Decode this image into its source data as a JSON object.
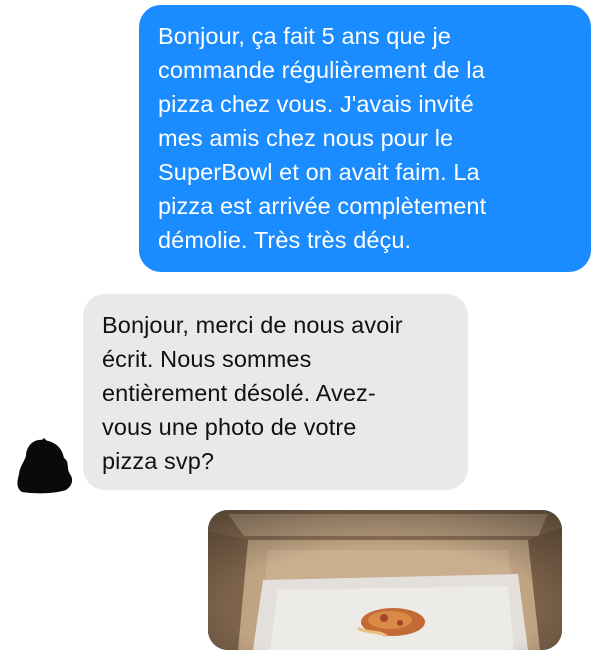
{
  "conversation": {
    "messages": [
      {
        "sender": "user",
        "text": "Bonjour, ça fait 5 ans que je\ncommande régulièrement de la\npizza chez vous. J'avais invité\nmes amis chez nous pour le\nSuperBowl et on avait faim. La\npizza est arrivée complètement\ndémolie. Très très déçu."
      },
      {
        "sender": "business",
        "text": "Bonjour, merci de nous avoir\nécrit. Nous sommes\nentièrement désolé. Avez-\nvous une photo de votre\npizza svp?"
      }
    ],
    "avatar_icon": "redacted-avatar",
    "attachment_icon": "pizza-box-photo"
  },
  "colors": {
    "outgoing_bubble": "#1a8cff",
    "incoming_bubble": "#e9e9eb"
  }
}
